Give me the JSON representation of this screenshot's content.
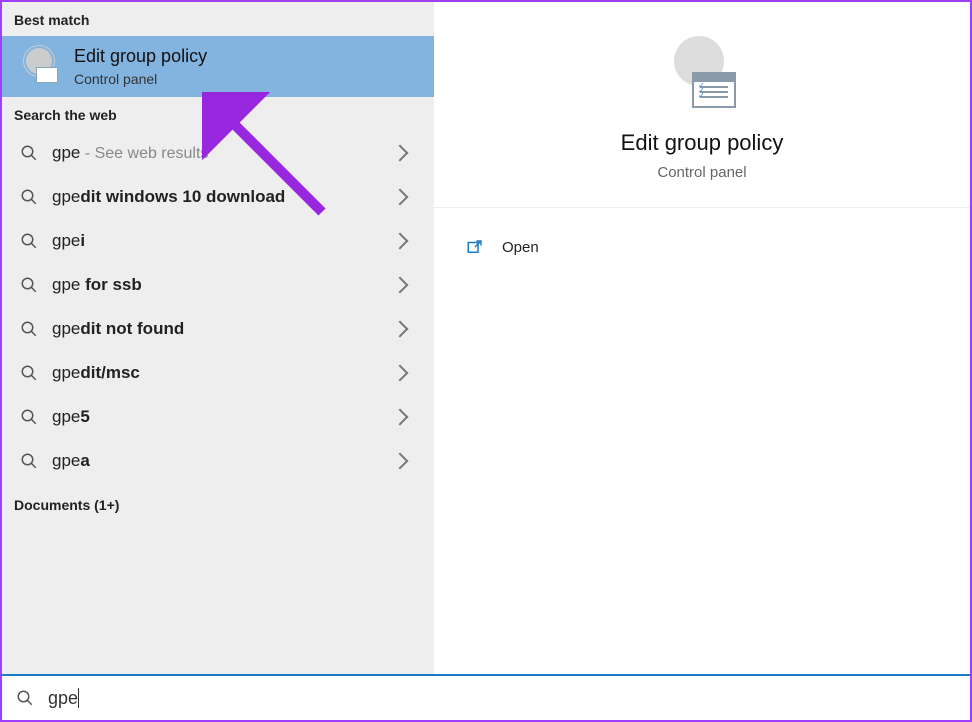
{
  "sections": {
    "bestMatchHeader": "Best match",
    "searchWebHeader": "Search the web",
    "documentsHeader": "Documents (1+)"
  },
  "bestMatch": {
    "title": "Edit group policy",
    "subtitle": "Control panel"
  },
  "webResults": [
    {
      "prefix": "gpe",
      "bold": "",
      "hint": " - See web results"
    },
    {
      "prefix": "gpe",
      "bold": "dit windows 10 download",
      "hint": ""
    },
    {
      "prefix": "gpe",
      "bold": "i",
      "hint": ""
    },
    {
      "prefix": "gpe ",
      "bold": "for ssb",
      "hint": ""
    },
    {
      "prefix": "gpe",
      "bold": "dit not found",
      "hint": ""
    },
    {
      "prefix": "gpe",
      "bold": "dit/msc",
      "hint": ""
    },
    {
      "prefix": "gpe",
      "bold": "5",
      "hint": ""
    },
    {
      "prefix": "gpe",
      "bold": "a",
      "hint": ""
    }
  ],
  "detail": {
    "title": "Edit group policy",
    "subtitle": "Control panel",
    "actions": {
      "open": "Open"
    }
  },
  "searchInput": {
    "value": "gpe"
  },
  "colors": {
    "accent": "#1a7cc4",
    "highlight": "#83b4e0",
    "annotation": "#9a27e0"
  }
}
